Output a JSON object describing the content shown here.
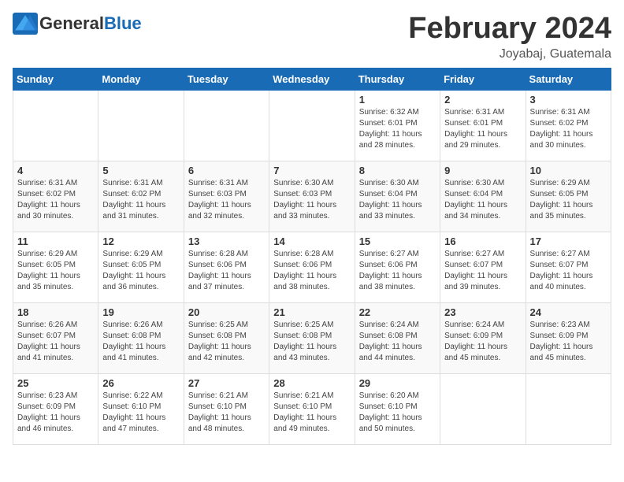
{
  "header": {
    "logo_general": "General",
    "logo_blue": "Blue",
    "month_title": "February 2024",
    "location": "Joyabaj, Guatemala"
  },
  "weekdays": [
    "Sunday",
    "Monday",
    "Tuesday",
    "Wednesday",
    "Thursday",
    "Friday",
    "Saturday"
  ],
  "weeks": [
    [
      {
        "day": "",
        "info": ""
      },
      {
        "day": "",
        "info": ""
      },
      {
        "day": "",
        "info": ""
      },
      {
        "day": "",
        "info": ""
      },
      {
        "day": "1",
        "info": "Sunrise: 6:32 AM\nSunset: 6:01 PM\nDaylight: 11 hours and 28 minutes."
      },
      {
        "day": "2",
        "info": "Sunrise: 6:31 AM\nSunset: 6:01 PM\nDaylight: 11 hours and 29 minutes."
      },
      {
        "day": "3",
        "info": "Sunrise: 6:31 AM\nSunset: 6:02 PM\nDaylight: 11 hours and 30 minutes."
      }
    ],
    [
      {
        "day": "4",
        "info": "Sunrise: 6:31 AM\nSunset: 6:02 PM\nDaylight: 11 hours and 30 minutes."
      },
      {
        "day": "5",
        "info": "Sunrise: 6:31 AM\nSunset: 6:02 PM\nDaylight: 11 hours and 31 minutes."
      },
      {
        "day": "6",
        "info": "Sunrise: 6:31 AM\nSunset: 6:03 PM\nDaylight: 11 hours and 32 minutes."
      },
      {
        "day": "7",
        "info": "Sunrise: 6:30 AM\nSunset: 6:03 PM\nDaylight: 11 hours and 33 minutes."
      },
      {
        "day": "8",
        "info": "Sunrise: 6:30 AM\nSunset: 6:04 PM\nDaylight: 11 hours and 33 minutes."
      },
      {
        "day": "9",
        "info": "Sunrise: 6:30 AM\nSunset: 6:04 PM\nDaylight: 11 hours and 34 minutes."
      },
      {
        "day": "10",
        "info": "Sunrise: 6:29 AM\nSunset: 6:05 PM\nDaylight: 11 hours and 35 minutes."
      }
    ],
    [
      {
        "day": "11",
        "info": "Sunrise: 6:29 AM\nSunset: 6:05 PM\nDaylight: 11 hours and 35 minutes."
      },
      {
        "day": "12",
        "info": "Sunrise: 6:29 AM\nSunset: 6:05 PM\nDaylight: 11 hours and 36 minutes."
      },
      {
        "day": "13",
        "info": "Sunrise: 6:28 AM\nSunset: 6:06 PM\nDaylight: 11 hours and 37 minutes."
      },
      {
        "day": "14",
        "info": "Sunrise: 6:28 AM\nSunset: 6:06 PM\nDaylight: 11 hours and 38 minutes."
      },
      {
        "day": "15",
        "info": "Sunrise: 6:27 AM\nSunset: 6:06 PM\nDaylight: 11 hours and 38 minutes."
      },
      {
        "day": "16",
        "info": "Sunrise: 6:27 AM\nSunset: 6:07 PM\nDaylight: 11 hours and 39 minutes."
      },
      {
        "day": "17",
        "info": "Sunrise: 6:27 AM\nSunset: 6:07 PM\nDaylight: 11 hours and 40 minutes."
      }
    ],
    [
      {
        "day": "18",
        "info": "Sunrise: 6:26 AM\nSunset: 6:07 PM\nDaylight: 11 hours and 41 minutes."
      },
      {
        "day": "19",
        "info": "Sunrise: 6:26 AM\nSunset: 6:08 PM\nDaylight: 11 hours and 41 minutes."
      },
      {
        "day": "20",
        "info": "Sunrise: 6:25 AM\nSunset: 6:08 PM\nDaylight: 11 hours and 42 minutes."
      },
      {
        "day": "21",
        "info": "Sunrise: 6:25 AM\nSunset: 6:08 PM\nDaylight: 11 hours and 43 minutes."
      },
      {
        "day": "22",
        "info": "Sunrise: 6:24 AM\nSunset: 6:08 PM\nDaylight: 11 hours and 44 minutes."
      },
      {
        "day": "23",
        "info": "Sunrise: 6:24 AM\nSunset: 6:09 PM\nDaylight: 11 hours and 45 minutes."
      },
      {
        "day": "24",
        "info": "Sunrise: 6:23 AM\nSunset: 6:09 PM\nDaylight: 11 hours and 45 minutes."
      }
    ],
    [
      {
        "day": "25",
        "info": "Sunrise: 6:23 AM\nSunset: 6:09 PM\nDaylight: 11 hours and 46 minutes."
      },
      {
        "day": "26",
        "info": "Sunrise: 6:22 AM\nSunset: 6:10 PM\nDaylight: 11 hours and 47 minutes."
      },
      {
        "day": "27",
        "info": "Sunrise: 6:21 AM\nSunset: 6:10 PM\nDaylight: 11 hours and 48 minutes."
      },
      {
        "day": "28",
        "info": "Sunrise: 6:21 AM\nSunset: 6:10 PM\nDaylight: 11 hours and 49 minutes."
      },
      {
        "day": "29",
        "info": "Sunrise: 6:20 AM\nSunset: 6:10 PM\nDaylight: 11 hours and 50 minutes."
      },
      {
        "day": "",
        "info": ""
      },
      {
        "day": "",
        "info": ""
      }
    ]
  ]
}
